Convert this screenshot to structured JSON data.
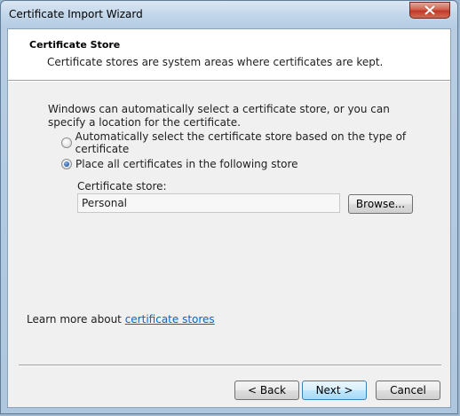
{
  "window": {
    "title": "Certificate Import Wizard"
  },
  "header": {
    "title": "Certificate Store",
    "description": "Certificate stores are system areas where certificates are kept."
  },
  "body": {
    "intro": "Windows can automatically select a certificate store, or you can specify a location for the certificate.",
    "options": [
      {
        "label": "Automatically select the certificate store based on the type of certificate",
        "checked": false
      },
      {
        "label": "Place all certificates in the following store",
        "checked": true
      }
    ],
    "store_label": "Certificate store:",
    "store_value": "Personal",
    "browse_label": "Browse..."
  },
  "footer": {
    "learn_prefix": "Learn more about",
    "learn_link": "certificate stores",
    "back_label": "< Back",
    "next_label": "Next >",
    "cancel_label": "Cancel"
  },
  "colors": {
    "link": "#0066cc",
    "close_button": "#c0392b"
  }
}
